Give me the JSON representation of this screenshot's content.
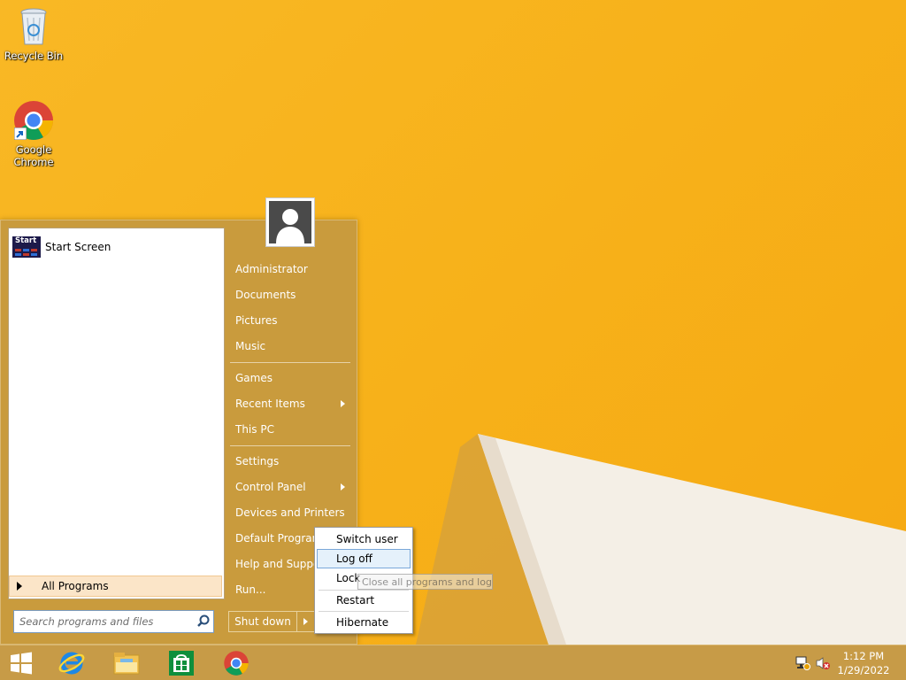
{
  "desktop": {
    "icons": [
      {
        "label": "Recycle Bin",
        "icon": "recycle-bin-icon"
      },
      {
        "label": "Google Chrome",
        "icon": "chrome-icon"
      }
    ]
  },
  "start_menu": {
    "programs": [
      {
        "label": "Start Screen",
        "icon_text": "Start",
        "icon": "start-screen-icon"
      }
    ],
    "all_programs": "All Programs",
    "search_placeholder": "Search programs and files",
    "right_items": [
      {
        "label": "Administrator",
        "arrow": false
      },
      {
        "label": "Documents",
        "arrow": false
      },
      {
        "label": "Pictures",
        "arrow": false
      },
      {
        "label": "Music",
        "arrow": false
      },
      {
        "label": "Games",
        "arrow": false
      },
      {
        "label": "Recent Items",
        "arrow": true
      },
      {
        "label": "This PC",
        "arrow": false
      },
      {
        "label": "Settings",
        "arrow": false
      },
      {
        "label": "Control Panel",
        "arrow": true
      },
      {
        "label": "Devices and Printers",
        "arrow": false
      },
      {
        "label": "Default Programs",
        "arrow": false
      },
      {
        "label": "Help and Support",
        "arrow": false
      },
      {
        "label": "Run...",
        "arrow": false
      }
    ],
    "shutdown_label": "Shut down"
  },
  "shutdown_menu": {
    "items": [
      "Switch user",
      "Log off",
      "Lock",
      "Restart",
      "Hibernate"
    ],
    "highlighted": "Log off"
  },
  "tooltip": "Close all programs and log off",
  "taskbar": {
    "pinned": [
      "start-button",
      "internet-explorer-icon",
      "file-explorer-icon",
      "store-icon",
      "chrome-icon"
    ],
    "time": "1:12 PM",
    "date": "1/29/2022"
  },
  "colors": {
    "wallpaper": "#f7b21b",
    "menu": "#c79a3e",
    "taskbar": "#c79b47",
    "highlight": "#e5f1fb"
  }
}
